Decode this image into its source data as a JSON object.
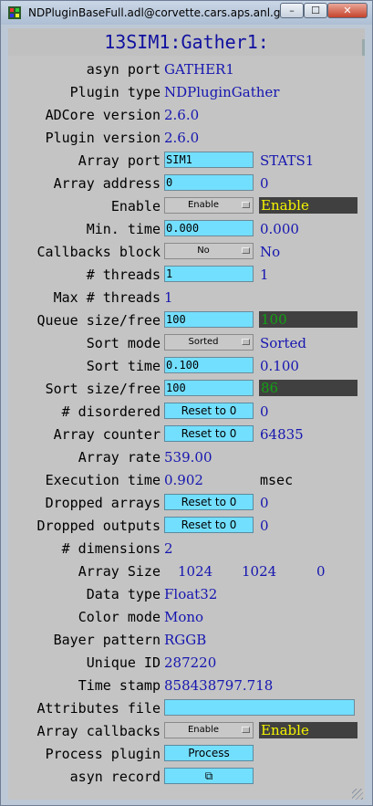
{
  "window": {
    "title": "NDPluginBaseFull.adl@corvette.cars.aps.anl.gov",
    "min_label": "–",
    "max_label": "☐",
    "close_label": "✕"
  },
  "panel_title": "13SIM1:Gather1:",
  "rows": {
    "asyn_port": {
      "label": "asyn port",
      "value": "GATHER1"
    },
    "plugin_type": {
      "label": "Plugin type",
      "value": "NDPluginGather"
    },
    "adcore_version": {
      "label": "ADCore version",
      "value": "2.6.0"
    },
    "plugin_version": {
      "label": "Plugin version",
      "value": "2.6.0"
    },
    "array_port": {
      "label": "Array port",
      "input": "SIM1",
      "readback": "STATS1"
    },
    "array_address": {
      "label": "Array address",
      "input": "0",
      "readback": "0"
    },
    "enable": {
      "label": "Enable",
      "menu": "Enable",
      "readback": "Enable"
    },
    "min_time": {
      "label": "Min. time",
      "input": "0.000",
      "readback": "0.000"
    },
    "callbacks_block": {
      "label": "Callbacks block",
      "menu": "No",
      "readback": "No"
    },
    "threads": {
      "label": "# threads",
      "input": "1",
      "readback": "1"
    },
    "max_threads": {
      "label": "Max # threads",
      "value": "1"
    },
    "queue": {
      "label": "Queue size/free",
      "input": "100",
      "readback": "100"
    },
    "sort_mode": {
      "label": "Sort mode",
      "menu": "Sorted",
      "readback": "Sorted"
    },
    "sort_time": {
      "label": "Sort time",
      "input": "0.100",
      "readback": "0.100"
    },
    "sort_size": {
      "label": "Sort size/free",
      "input": "100",
      "readback": "86"
    },
    "disordered": {
      "label": "# disordered",
      "button": "Reset to 0",
      "readback": "0"
    },
    "array_counter": {
      "label": "Array counter",
      "button": "Reset to 0",
      "readback": "64835"
    },
    "array_rate": {
      "label": "Array rate",
      "value": "539.00"
    },
    "execution_time": {
      "label": "Execution time",
      "value": "0.902",
      "unit": "msec"
    },
    "dropped_arrays": {
      "label": "Dropped arrays",
      "button": "Reset to 0",
      "readback": "0"
    },
    "dropped_outputs": {
      "label": "Dropped outputs",
      "button": "Reset to 0",
      "readback": "0"
    },
    "dimensions": {
      "label": "# dimensions",
      "value": "2"
    },
    "array_size": {
      "label": "Array Size",
      "values": [
        "1024",
        "1024",
        "0"
      ]
    },
    "data_type": {
      "label": "Data type",
      "value": "Float32"
    },
    "color_mode": {
      "label": "Color mode",
      "value": "Mono"
    },
    "bayer_pattern": {
      "label": "Bayer pattern",
      "value": "RGGB"
    },
    "unique_id": {
      "label": "Unique ID",
      "value": "287220"
    },
    "time_stamp": {
      "label": "Time stamp",
      "value": "858438797.718"
    },
    "attributes_file": {
      "label": "Attributes file",
      "input": ""
    },
    "array_callbacks": {
      "label": "Array callbacks",
      "menu": "Enable",
      "readback": "Enable"
    },
    "process_plugin": {
      "label": "Process plugin",
      "button": "Process"
    },
    "asyn_record": {
      "label": "asyn record",
      "button": "⧉"
    }
  },
  "colors": {
    "entry_bg": "#73dfff",
    "readback_blue": "#1515b0",
    "title_blue": "#1010a0",
    "alarm_green": "#0c9b0c",
    "enabled_yellow": "#f5f500",
    "dark_box": "#404040"
  }
}
